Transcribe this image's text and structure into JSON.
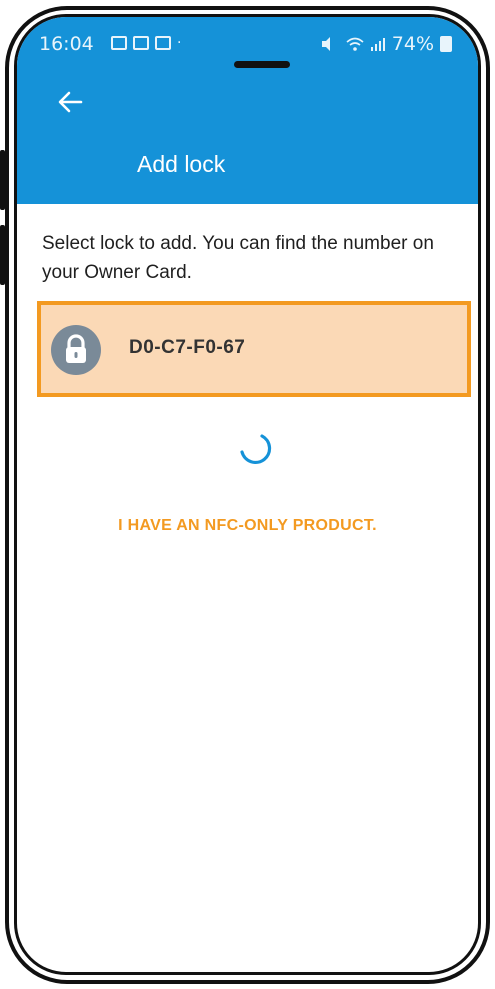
{
  "status_bar": {
    "time": "16:04",
    "battery": "74%"
  },
  "header": {
    "title": "Add lock"
  },
  "content": {
    "instruction": "Select lock to add. You can find the number on your Owner Card."
  },
  "locks": [
    {
      "id": "D0-C7-F0-67",
      "selected": true
    }
  ],
  "actions": {
    "nfc_only_label": "I HAVE AN NFC-ONLY PRODUCT."
  },
  "colors": {
    "header_bg": "#1592d8",
    "selected_bg": "#fbd9b6",
    "accent": "#f39a21",
    "avatar_bg": "#7a8a98"
  },
  "icons": [
    "back-arrow-icon",
    "lock-icon",
    "loading-spinner-icon",
    "image-icon",
    "mail-icon",
    "gmail-icon",
    "wifi-icon",
    "signal-icon",
    "battery-icon"
  ]
}
